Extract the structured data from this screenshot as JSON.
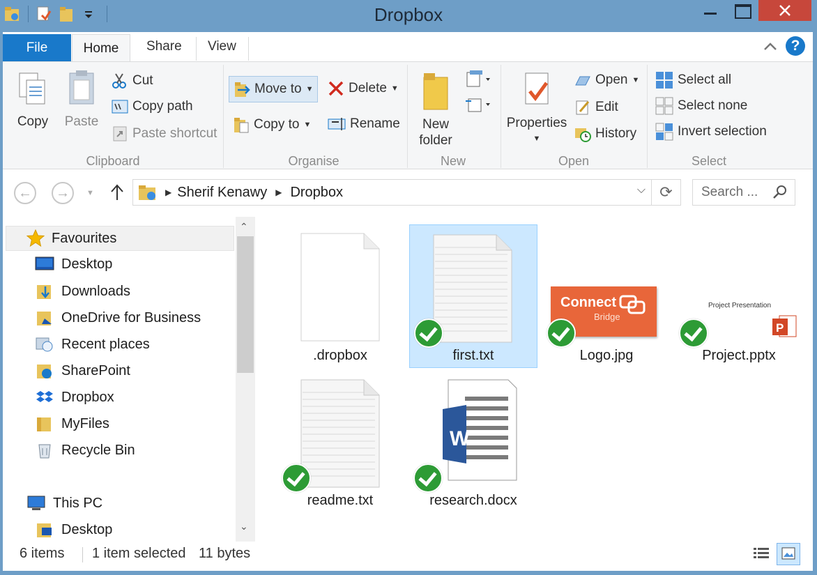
{
  "window": {
    "title": "Dropbox"
  },
  "colors": {
    "frame": "#6e9ec7",
    "file_tab": "#1979ca",
    "close": "#c7473b",
    "selection": "#cce8ff",
    "sync_check": "#2d9b35"
  },
  "tabs": {
    "file": "File",
    "home": "Home",
    "share": "Share",
    "view": "View"
  },
  "ribbon": {
    "clipboard": {
      "label": "Clipboard",
      "copy": "Copy",
      "paste": "Paste",
      "cut": "Cut",
      "copy_path": "Copy path",
      "paste_shortcut": "Paste shortcut"
    },
    "organise": {
      "label": "Organise",
      "move_to": "Move to",
      "copy_to": "Copy to",
      "delete": "Delete",
      "rename": "Rename"
    },
    "new": {
      "label": "New",
      "new_folder_1": "New",
      "new_folder_2": "folder"
    },
    "open": {
      "label": "Open",
      "properties": "Properties",
      "open": "Open",
      "edit": "Edit",
      "history": "History"
    },
    "select": {
      "label": "Select",
      "select_all": "Select all",
      "select_none": "Select none",
      "invert_selection": "Invert selection"
    }
  },
  "address": {
    "crumbs": [
      "Sherif Kenawy",
      "Dropbox"
    ],
    "search_placeholder": "Search ..."
  },
  "nav": {
    "favourites": "Favourites",
    "items": [
      "Desktop",
      "Downloads",
      "OneDrive for Business",
      "Recent places",
      "SharePoint",
      "Dropbox",
      "MyFiles",
      "Recycle Bin"
    ],
    "this_pc": "This PC",
    "pc_items": [
      "Desktop"
    ]
  },
  "files": [
    {
      "name": ".dropbox",
      "synced": false,
      "selected": false
    },
    {
      "name": "first.txt",
      "synced": true,
      "selected": true
    },
    {
      "name": "Logo.jpg",
      "synced": true,
      "selected": false,
      "thumb_text_1": "Connect",
      "thumb_text_2": "Bridge"
    },
    {
      "name": "Project.pptx",
      "synced": true,
      "selected": false,
      "thumb_text": "Project Presentation"
    },
    {
      "name": "readme.txt",
      "synced": true,
      "selected": false
    },
    {
      "name": "research.docx",
      "synced": true,
      "selected": false,
      "badge": "W"
    }
  ],
  "status": {
    "items": "6 items",
    "selected": "1 item selected",
    "size": "11 bytes"
  }
}
